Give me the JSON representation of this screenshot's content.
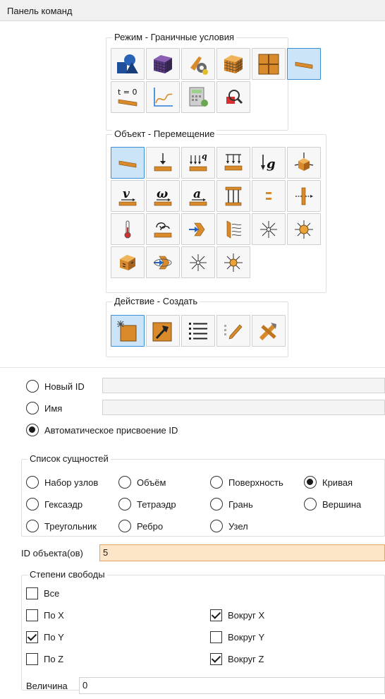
{
  "title": "Панель команд",
  "mode_group": {
    "title": "Режим - Граничные условия",
    "buttons": [
      {
        "icon": "geometry-icon",
        "selected": false
      },
      {
        "icon": "mesh-icon",
        "selected": false
      },
      {
        "icon": "material-properties-icon",
        "selected": false
      },
      {
        "icon": "mesh-orange-icon",
        "selected": false
      },
      {
        "icon": "partition-icon",
        "selected": false
      },
      {
        "icon": "boundary-conditions-icon",
        "selected": true
      },
      {
        "icon": "initial-condition-icon",
        "selected": false,
        "text": "t = 0"
      },
      {
        "icon": "curve-function-icon",
        "selected": false
      },
      {
        "icon": "calculator-icon",
        "selected": false
      },
      {
        "icon": "inspect-icon",
        "selected": false
      }
    ]
  },
  "object_group": {
    "title": "Объект - Перемещение",
    "buttons": [
      {
        "icon": "displacement-icon",
        "selected": true
      },
      {
        "icon": "force-icon",
        "selected": false
      },
      {
        "icon": "pressure-icon",
        "selected": false,
        "text": "q"
      },
      {
        "icon": "distributed-load-icon",
        "selected": false
      },
      {
        "icon": "gravity-icon",
        "selected": false,
        "text": "g"
      },
      {
        "icon": "acceleration-body-icon",
        "selected": false
      },
      {
        "icon": "velocity-icon",
        "selected": false,
        "text": "v"
      },
      {
        "icon": "angular-velocity-icon",
        "selected": false,
        "text": "ω"
      },
      {
        "icon": "acceleration-icon",
        "selected": false,
        "text": "a"
      },
      {
        "icon": "constraint-frame-icon",
        "selected": false
      },
      {
        "icon": "contact-icon",
        "selected": false
      },
      {
        "icon": "connector-icon",
        "selected": false
      },
      {
        "icon": "temperature-icon",
        "selected": false
      },
      {
        "icon": "convection-icon",
        "selected": false
      },
      {
        "icon": "heat-flux-icon",
        "selected": false
      },
      {
        "icon": "radiation-icon",
        "selected": false
      },
      {
        "icon": "heat-source-icon",
        "selected": false
      },
      {
        "icon": "heat-generation-icon",
        "selected": false
      },
      {
        "icon": "volume-heat-icon",
        "selected": false
      },
      {
        "icon": "rotation-flux-icon",
        "selected": false
      },
      {
        "icon": "point-source-icon",
        "selected": false
      },
      {
        "icon": "point-heat-icon",
        "selected": false
      }
    ]
  },
  "action_group": {
    "title": "Действие - Создать",
    "buttons": [
      {
        "icon": "create-icon",
        "selected": true
      },
      {
        "icon": "modify-icon",
        "selected": false
      },
      {
        "icon": "list-icon",
        "selected": false
      },
      {
        "icon": "edit-icon",
        "selected": false
      },
      {
        "icon": "delete-icon",
        "selected": false
      }
    ]
  },
  "id_options": {
    "new_id_label": "Новый ID",
    "new_id_value": "",
    "name_label": "Имя",
    "name_value": "",
    "auto_label": "Автоматическое присвоение ID",
    "selected": "auto"
  },
  "entity_list": {
    "title": "Список сущностей",
    "options": [
      {
        "label": "Набор узлов",
        "selected": false
      },
      {
        "label": "Объём",
        "selected": false
      },
      {
        "label": "Поверхность",
        "selected": false
      },
      {
        "label": "Кривая",
        "selected": true
      },
      {
        "label": "Гексаэдр",
        "selected": false
      },
      {
        "label": "Тетраэдр",
        "selected": false
      },
      {
        "label": "Грань",
        "selected": false
      },
      {
        "label": "Вершина",
        "selected": false
      },
      {
        "label": "Треугольник",
        "selected": false
      },
      {
        "label": "Ребро",
        "selected": false
      },
      {
        "label": "Узел",
        "selected": false
      }
    ]
  },
  "object_ids": {
    "label": "ID объекта(ов)",
    "value": "5"
  },
  "dof": {
    "title": "Степени свободы",
    "all": {
      "label": "Все",
      "checked": false
    },
    "items": [
      {
        "label": "По X",
        "checked": false
      },
      {
        "label": "Вокруг X",
        "checked": true
      },
      {
        "label": "По Y",
        "checked": true
      },
      {
        "label": "Вокруг Y",
        "checked": false
      },
      {
        "label": "По Z",
        "checked": false
      },
      {
        "label": "Вокруг Z",
        "checked": true
      }
    ]
  },
  "magnitude": {
    "label": "Величина",
    "value": "0"
  },
  "colors": {
    "accent_selected": "#cce4f7",
    "accent_border": "#3a8fd6",
    "ids_field": "#fde5c8",
    "icon_orange": "#d98a2b",
    "icon_blue": "#1f4f9a"
  }
}
